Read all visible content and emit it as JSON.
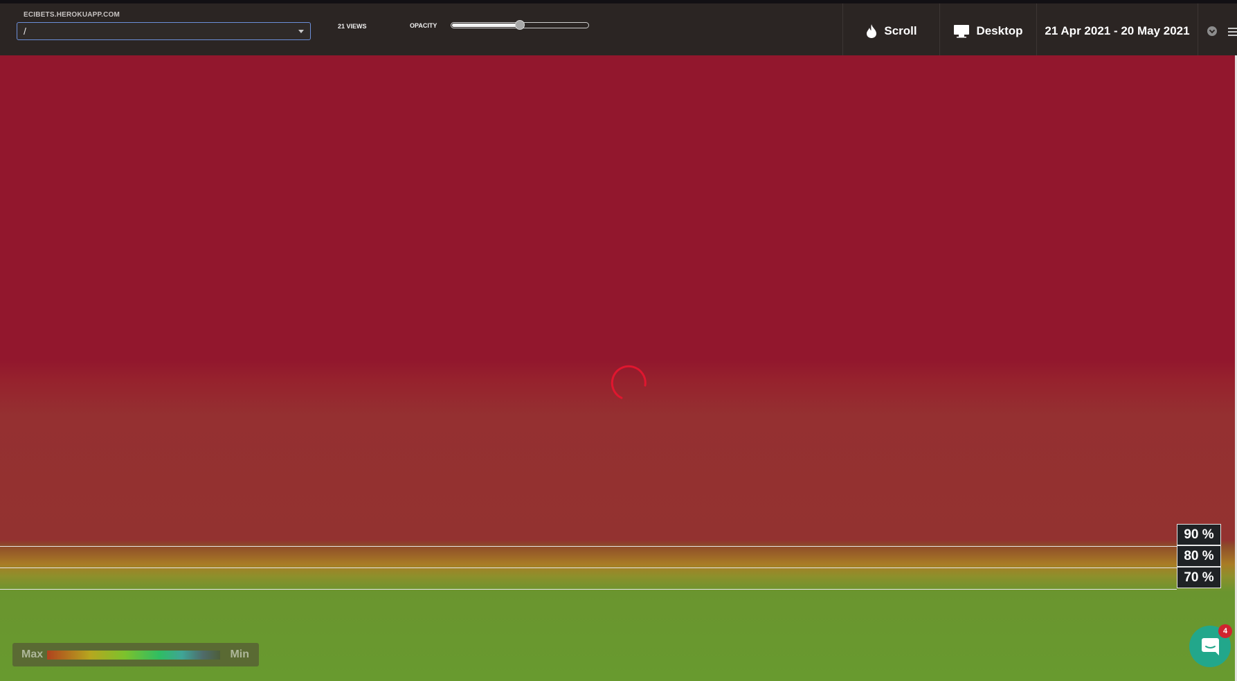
{
  "toolbar": {
    "site": "ECIBETS.HEROKUAPP.COM",
    "page_path": "/",
    "views": "21 VIEWS",
    "opacity_label": "OPACITY",
    "opacity_value": 0.5,
    "heatmap_type": "Scroll",
    "device": "Desktop",
    "date_range": "21 Apr 2021 - 20 May 2021"
  },
  "heatmap": {
    "folds": [
      {
        "label": "90 %"
      },
      {
        "label": "80 %"
      },
      {
        "label": "70 %"
      }
    ],
    "loading": true
  },
  "legend": {
    "max": "Max",
    "min": "Min"
  },
  "chat": {
    "unread": "4"
  },
  "colors": {
    "topbar": "#2b2523",
    "hot": "#92172d",
    "warm": "#933230",
    "cool": "#689a2f",
    "spinner": "#e0162f",
    "chat": "#22a78b",
    "badge": "#d0242f"
  }
}
